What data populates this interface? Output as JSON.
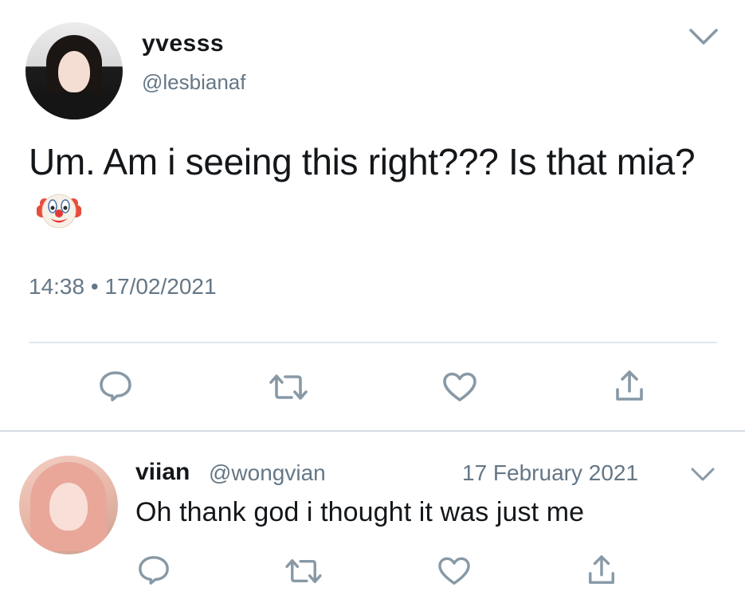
{
  "tweet": {
    "display_name": "yvesss",
    "handle": "@lesbianaf",
    "text": "Um. Am i seeing this right??? Is that mia?",
    "emoji": "clown-face",
    "timestamp": "14:38 • 17/02/2021"
  },
  "reply": {
    "display_name": "viian",
    "handle": "@wongvian",
    "date": "17 February 2021",
    "text": "Oh thank god i thought it was just me"
  },
  "icons": {
    "menu": "chevron-down-icon",
    "reply": "reply-icon",
    "retweet": "retweet-icon",
    "like": "heart-icon",
    "share": "share-icon"
  },
  "colors": {
    "text": "#14171a",
    "secondary": "#657786",
    "divider": "#e1e8ed"
  }
}
